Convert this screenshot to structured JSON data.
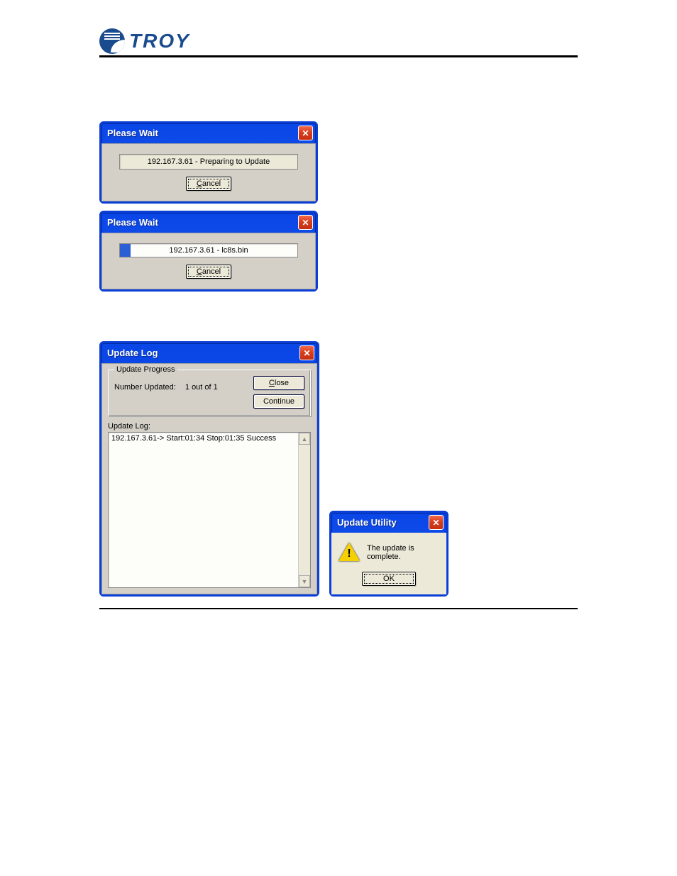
{
  "logo_text": "TROY",
  "wait1": {
    "title": "Please Wait",
    "status": "192.167.3.61 - Preparing to Update",
    "cancel": "Cancel"
  },
  "wait2": {
    "title": "Please Wait",
    "progress_label": "192.167.3.61 - lc8s.bin",
    "progress_pct": 6,
    "cancel": "Cancel"
  },
  "log": {
    "title": "Update Log",
    "group_label": "Update Progress",
    "number_label": "Number Updated:",
    "number_value": "1  out of   1",
    "close": "Close",
    "continue": "Continue",
    "log_label": "Update Log:",
    "log_text": "192.167.3.61-> Start:01:34 Stop:01:35  Success"
  },
  "complete": {
    "title": "Update Utility",
    "message": "The update is complete.",
    "ok": "OK"
  }
}
